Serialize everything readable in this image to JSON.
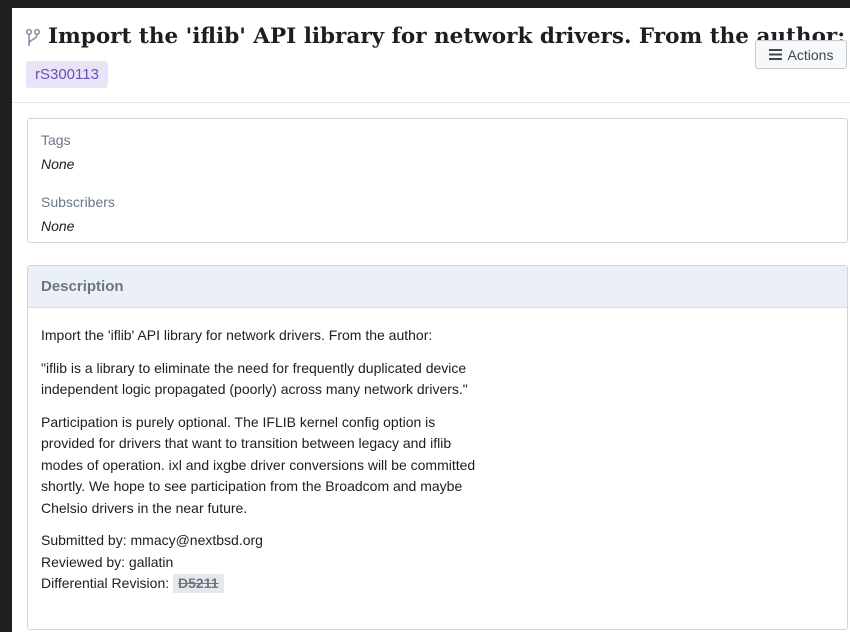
{
  "header": {
    "title": "Import the 'iflib' API library for network drivers. From the author:",
    "commit_id": "rS300113",
    "actions_label": "Actions"
  },
  "properties": {
    "tags_label": "Tags",
    "tags_value": "None",
    "subscribers_label": "Subscribers",
    "subscribers_value": "None"
  },
  "description": {
    "heading": "Description",
    "p1": "Import the 'iflib' API library for network drivers. From the author:",
    "p2_lines": [
      "\"iflib is a library to eliminate the need for frequently duplicated device",
      "independent logic propagated (poorly) across many network drivers.\""
    ],
    "p3_lines": [
      "Participation is purely optional. The IFLIB kernel config option is",
      "provided for drivers that want to transition between legacy and iflib",
      "modes of operation. ixl and ixgbe driver conversions will be committed",
      "shortly. We hope to see participation from the Broadcom and maybe",
      "Chelsio drivers in the near future."
    ],
    "submitted_by": "Submitted by: mmacy@nextbsd.org",
    "reviewed_by": "Reviewed by: gallatin",
    "revision_label": "Differential Revision:",
    "revision_id": "D5211"
  },
  "colors": {
    "accent_purple": "#6b4fb8",
    "panel_header_bg": "#ebf0f7",
    "muted_text": "#6b7785"
  },
  "icons": {
    "title_icon": "branch-icon",
    "actions_icon": "hamburger-menu-icon"
  }
}
